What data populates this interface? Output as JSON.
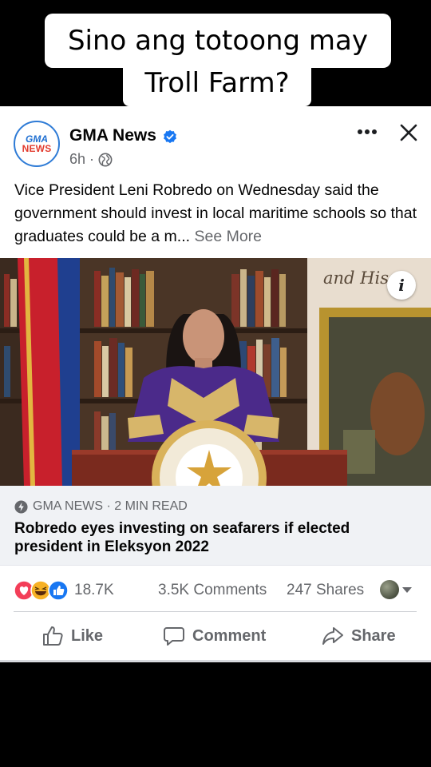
{
  "caption": {
    "line1": "Sino ang totoong may",
    "line2": "Troll Farm?"
  },
  "post": {
    "page_logo": {
      "top": "GMA",
      "bottom": "NEWS"
    },
    "page_name": "GMA News",
    "verified": true,
    "time": "6h",
    "audience_icon": "globe-icon",
    "body": "Vice President Leni Robredo on Wednesday said the government should invest in local maritime schools so that graduates could be a m...",
    "see_more": "See More",
    "photo_overlay_text": "and His",
    "link": {
      "source": "GMA NEWS · 2 MIN READ",
      "title": "Robredo eyes investing on seafarers if elected president in Eleksyon 2022"
    },
    "stats": {
      "reaction_icons": [
        "love-reaction-icon",
        "haha-reaction-icon",
        "like-reaction-icon"
      ],
      "reactions": "18.7K",
      "comments": "3.5K Comments",
      "shares": "247 Shares"
    },
    "actions": {
      "like": "Like",
      "comment": "Comment",
      "share": "Share"
    }
  },
  "colors": {
    "accent_blue": "#1877f2",
    "muted_text": "#65676b",
    "love_red": "#f33e58",
    "haha_yellow": "#f7b125"
  }
}
